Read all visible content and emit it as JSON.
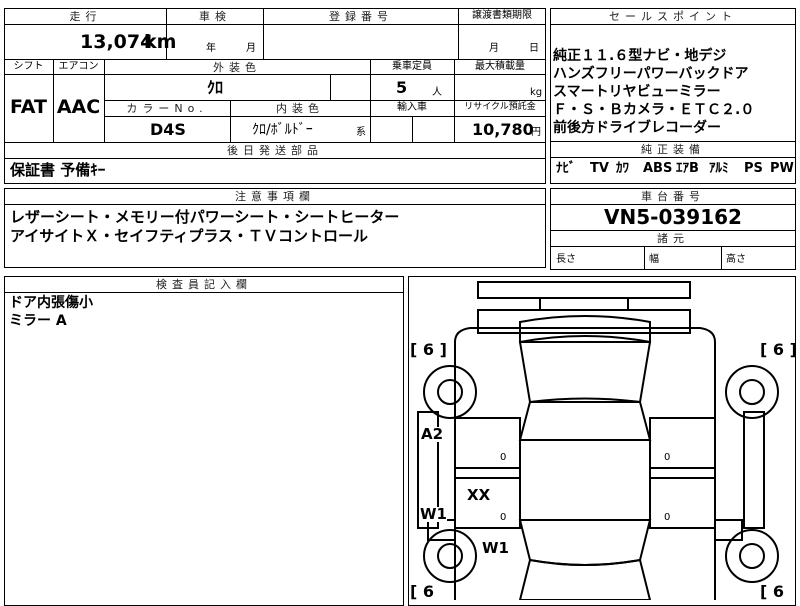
{
  "top": {
    "mileage_label": "走行",
    "mileage_value": "13,074",
    "mileage_unit": "km",
    "shaken_label": "車検",
    "shaken_year": "年",
    "shaken_month": "月",
    "reg_no_label": "登録番号",
    "transfer_label": "譲渡書類期限",
    "transfer_month": "月",
    "transfer_day": "日"
  },
  "row2": {
    "shift_label": "シフト",
    "shift_value": "FAT",
    "ac_label": "エアコン",
    "ac_value": "AAC",
    "ext_color_label": "外装色",
    "ext_color_value": "ｸﾛ",
    "capacity_label": "乗車定員",
    "capacity_value": "5",
    "capacity_unit": "人",
    "max_load_label": "最大積載量",
    "max_load_unit": "kg",
    "color_no_label": "カラーNo.",
    "color_no_value": "D4S",
    "int_color_label": "内装色",
    "int_color_value": "ｸﾛ/ﾎﾞﾙﾄﾞｰ",
    "int_color_suffix": "系",
    "import_label": "輸入車",
    "recycle_label": "リサイクル預託金",
    "recycle_value": "10,780",
    "recycle_unit": "円"
  },
  "later": {
    "label": "後日発送部品",
    "value": "保証書 予備ｷｰ"
  },
  "notes": {
    "label": "注意事項欄",
    "line1": "レザーシート・メモリー付パワーシート・シートヒーター",
    "line2": "アイサイトＸ・セイフティプラス・ＴＶコントロール"
  },
  "sales": {
    "label": "セールスポイント",
    "lines": [
      "純正１１.６型ナビ・地デジ",
      "ハンズフリーパワーバックドア",
      "スマートリヤビューミラー",
      "Ｆ・Ｓ・Ｂカメラ・ＥＴＣ２.０",
      "前後方ドライブレコーダー"
    ]
  },
  "equipment": {
    "label": "純正装備",
    "items": [
      "ﾅﾋﾞ",
      "TV",
      "ｶﾜ",
      "ABS",
      "ｴｱB",
      "ｱﾙﾐ",
      "PS",
      "PW"
    ]
  },
  "chassis": {
    "label": "車台番号",
    "value": "VN5-039162",
    "specs_label": "諸元",
    "length_label": "長さ",
    "width_label": "幅",
    "height_label": "高さ"
  },
  "inspector": {
    "label": "検査員記入欄",
    "line1": "ドア内張傷小",
    "line2": "ミラー A"
  },
  "diagram": {
    "tire_marks": [
      "[ 6 ]",
      "[ 6 ]",
      "[ 6",
      "[ 6"
    ],
    "marks": [
      "A2",
      "W1",
      "XX",
      "W1"
    ],
    "zeros": [
      "0",
      "0",
      "0",
      "0"
    ]
  }
}
